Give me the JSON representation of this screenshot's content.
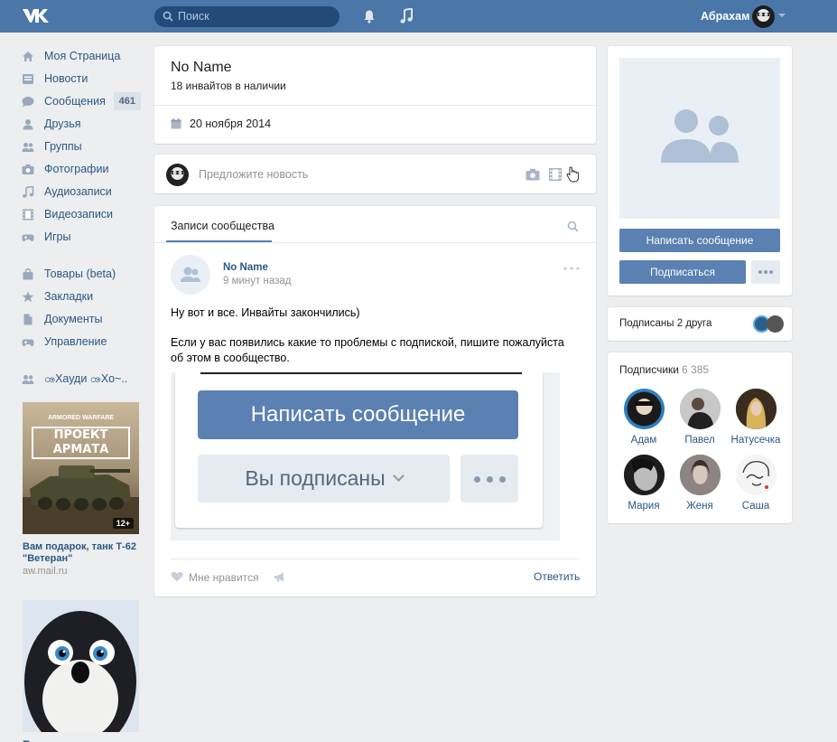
{
  "header": {
    "search_placeholder": "Поиск",
    "username": "Абрахам"
  },
  "nav": {
    "items": [
      {
        "label": "Моя Страница"
      },
      {
        "label": "Новости"
      },
      {
        "label": "Сообщения",
        "badge": "461"
      },
      {
        "label": "Друзья"
      },
      {
        "label": "Группы"
      },
      {
        "label": "Фотографии"
      },
      {
        "label": "Аудиозаписи"
      },
      {
        "label": "Видеозаписи"
      },
      {
        "label": "Игры"
      }
    ],
    "items2": [
      {
        "label": "Товары (beta)"
      },
      {
        "label": "Закладки"
      },
      {
        "label": "Документы"
      },
      {
        "label": "Управление"
      }
    ],
    "group_link": "ꧼХауди ꧼХо~.."
  },
  "ads": [
    {
      "title": "Вам подарок, танк Т-62 \"Ветеран\"",
      "url": "aw.mail.ru",
      "img_text": "ПРОЕКТ АРМАТА",
      "img_sub": "ARMORED WARFARE",
      "badge": "12+"
    },
    {
      "title": "П",
      "url": ""
    }
  ],
  "group": {
    "name": "No Name",
    "subtitle": "18 инвайтов в наличии",
    "date": "20 ноября 2014"
  },
  "composer": {
    "placeholder": "Предложите новость"
  },
  "feed": {
    "tab": "Записи сообщества",
    "post": {
      "author": "No Name",
      "time": "9 минут назад",
      "text1": "Ну вот и все. Инвайты закончились)",
      "text2": "Если у вас появились какие то проблемы с подпиской, пишите пожалуйста об этом в сообщество.",
      "img_btn1": "Написать сообщение",
      "img_btn2": "Вы подписаны"
    },
    "like_label": "Мне нравится",
    "reply_label": "Ответить"
  },
  "profile": {
    "btn_message": "Написать сообщение",
    "btn_subscribe": "Подписаться"
  },
  "friends_text": "Подписаны 2 друга",
  "subscribers": {
    "title": "Подписчики",
    "count": "6 385",
    "people": [
      {
        "name": "Адам",
        "color": "#2e7fc1"
      },
      {
        "name": "Павел",
        "color": "#8a8a8a"
      },
      {
        "name": "Натусечка",
        "color": "#3a2c1e"
      },
      {
        "name": "Мария",
        "color": "#4a4a4a"
      },
      {
        "name": "Женя",
        "color": "#7a6e6a"
      },
      {
        "name": "Саша",
        "color": "#f2f2f2"
      }
    ]
  },
  "colors": {
    "brand": "#4a76a8",
    "link": "#2a5885",
    "button": "#5b80b2"
  }
}
